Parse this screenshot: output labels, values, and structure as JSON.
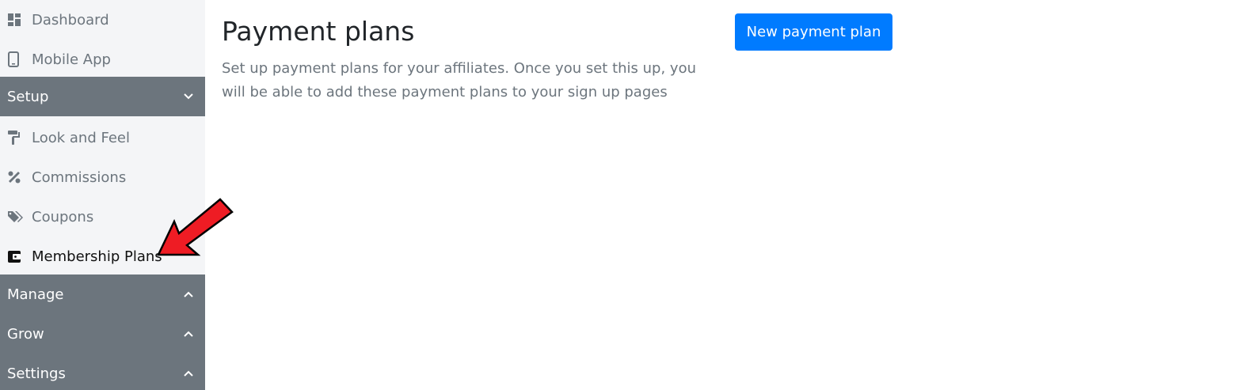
{
  "sidebar": {
    "items_top": [
      {
        "label": "Dashboard",
        "icon": "dashboard-icon"
      },
      {
        "label": "Mobile App",
        "icon": "mobile-icon"
      }
    ],
    "setup": {
      "label": "Setup",
      "expanded": true,
      "items": [
        {
          "label": "Look and Feel",
          "icon": "paint-roller-icon"
        },
        {
          "label": "Commissions",
          "icon": "percent-icon"
        },
        {
          "label": "Coupons",
          "icon": "tags-icon"
        },
        {
          "label": "Membership Plans",
          "icon": "wallet-icon",
          "active": true
        }
      ]
    },
    "sections": [
      {
        "label": "Manage",
        "expanded": false
      },
      {
        "label": "Grow",
        "expanded": false
      },
      {
        "label": "Settings",
        "expanded": false
      }
    ]
  },
  "main": {
    "title": "Payment plans",
    "description": "Set up payment plans for your affiliates. Once you set this up, you will be able to add these payment plans to your sign up pages",
    "new_button_label": "New payment plan"
  },
  "colors": {
    "sidebar_bg": "#f4f5f7",
    "section_bg": "#6c757d",
    "primary": "#007bff",
    "annotation_arrow": "#ee1c24"
  }
}
